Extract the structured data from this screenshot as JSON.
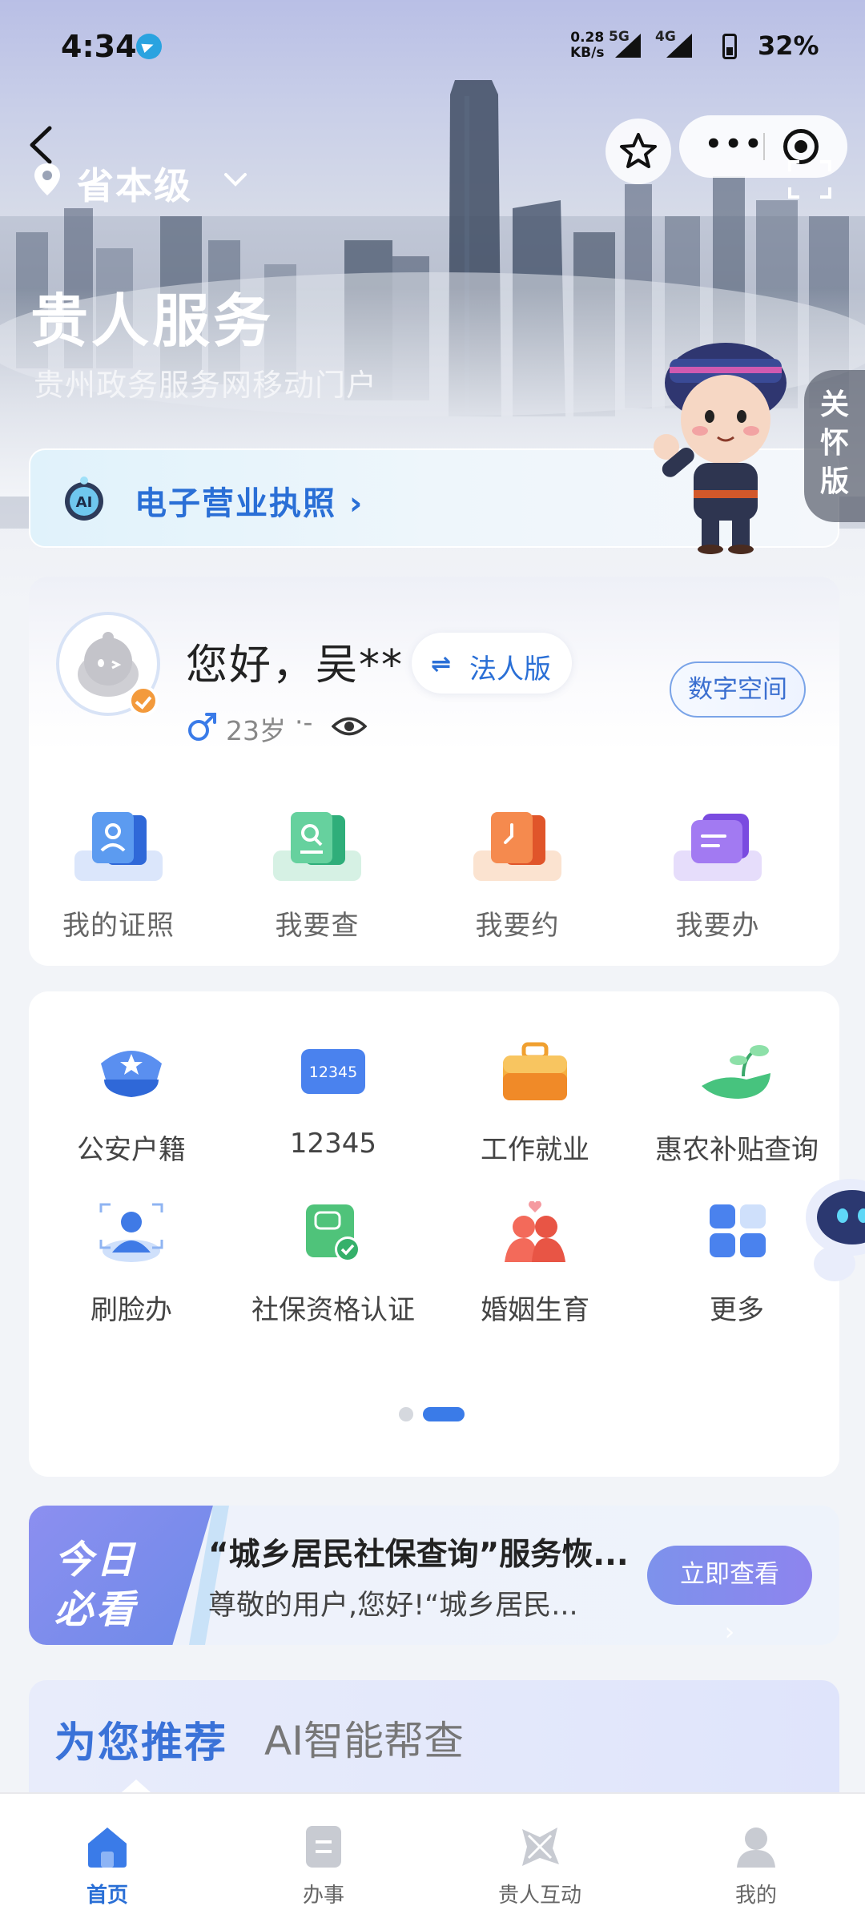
{
  "status_bar": {
    "time": "4:34",
    "net_speed_value": "0.28",
    "net_speed_unit": "KB/s",
    "sim1": "5G",
    "sim2": "4G",
    "battery": "32%"
  },
  "header": {
    "location": "省本级",
    "title": "贵人服务",
    "subtitle": "贵州政务服务网移动门户",
    "care_mode": "关怀版",
    "license_banner": "电子营业执照"
  },
  "user": {
    "greeting": "您好，吴**",
    "switch_label": "法人版",
    "digital_space": "数字空间",
    "age": "23岁",
    "extra": "·-"
  },
  "quick_actions": [
    {
      "label": "我的证照",
      "icon": "license-card-icon"
    },
    {
      "label": "我要查",
      "icon": "search-doc-icon"
    },
    {
      "label": "我要约",
      "icon": "appointment-clock-icon"
    },
    {
      "label": "我要办",
      "icon": "task-folder-icon"
    }
  ],
  "services": [
    {
      "label": "公安户籍",
      "icon": "police-cap-icon"
    },
    {
      "label": "12345",
      "icon": "hotline-12345-icon",
      "badge_text": "12345"
    },
    {
      "label": "工作就业",
      "icon": "briefcase-icon"
    },
    {
      "label": "惠农补贴查询",
      "icon": "farm-subsidy-icon"
    },
    {
      "label": "刷脸办",
      "icon": "face-scan-icon"
    },
    {
      "label": "社保资格认证",
      "icon": "social-security-icon"
    },
    {
      "label": "婚姻生育",
      "icon": "marriage-icon"
    },
    {
      "label": "更多",
      "icon": "more-grid-icon"
    }
  ],
  "pager": {
    "current": 2,
    "total": 2
  },
  "today": {
    "tag_line1": "今日",
    "tag_line2": "必看",
    "title": "“城乡居民社保查询”服务恢...",
    "desc": "尊敬的用户,您好!“城乡居民...",
    "button": "立即查看"
  },
  "recommend": {
    "tab_active": "为您推荐",
    "tab_other": "AI智能帮查"
  },
  "tabbar": [
    {
      "label": "首页",
      "icon": "home-icon",
      "active": true
    },
    {
      "label": "办事",
      "icon": "document-icon",
      "active": false
    },
    {
      "label": "贵人互动",
      "icon": "interact-icon",
      "active": false
    },
    {
      "label": "我的",
      "icon": "profile-icon",
      "active": false
    }
  ],
  "colors": {
    "primary": "#2a6fd6",
    "accent_orange": "#f39a3c",
    "purple_button": "#8d84ee"
  }
}
